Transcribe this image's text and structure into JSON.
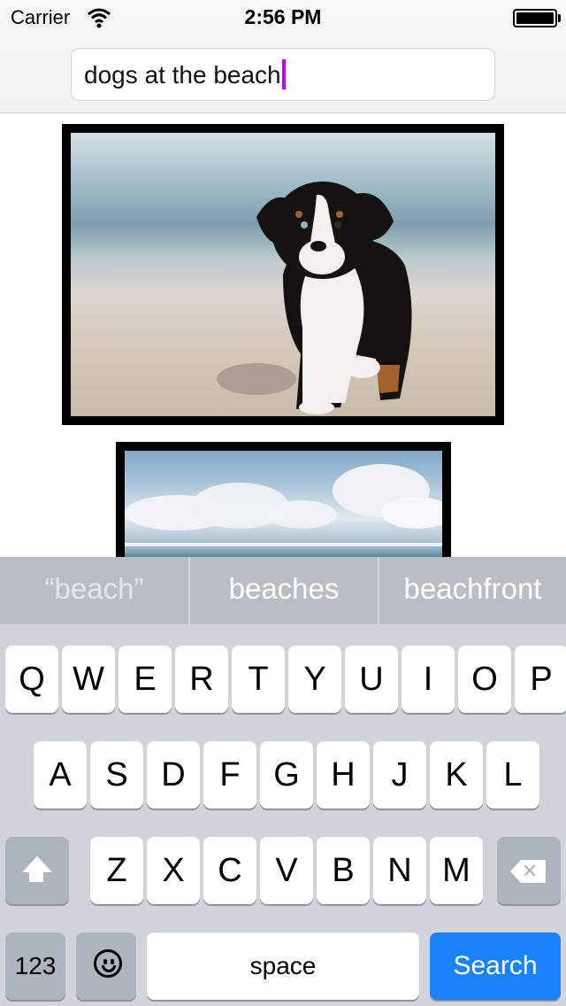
{
  "status": {
    "carrier": "Carrier",
    "time": "2:56 PM",
    "wifi_icon": "wifi-icon",
    "battery_icon": "battery-icon"
  },
  "search": {
    "query": "dogs at the beach"
  },
  "results": [
    {
      "description_icon": "photo-dog-on-beach"
    },
    {
      "description_icon": "photo-beach-sky"
    }
  ],
  "keyboard": {
    "suggestions": [
      "“beach”",
      "beaches",
      "beachfront"
    ],
    "row1": [
      "Q",
      "W",
      "E",
      "R",
      "T",
      "Y",
      "U",
      "I",
      "O",
      "P"
    ],
    "row2": [
      "A",
      "S",
      "D",
      "F",
      "G",
      "H",
      "J",
      "K",
      "L"
    ],
    "row3": [
      "Z",
      "X",
      "C",
      "V",
      "B",
      "N",
      "M"
    ],
    "numbers_label": "123",
    "space_label": "space",
    "search_label": "Search",
    "accent_color": "#1a82fb",
    "caret_color": "#c000ff"
  }
}
